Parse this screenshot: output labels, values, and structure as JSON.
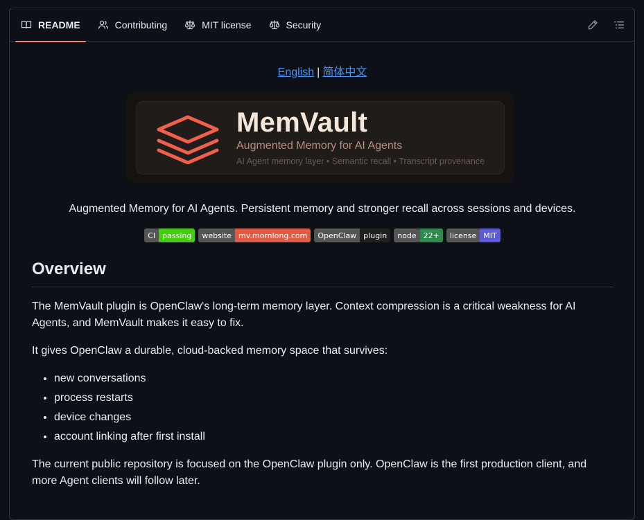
{
  "tabs": [
    {
      "label": "README",
      "icon": "book-icon"
    },
    {
      "label": "Contributing",
      "icon": "people-icon"
    },
    {
      "label": "MIT license",
      "icon": "law-icon"
    },
    {
      "label": "Security",
      "icon": "law-icon"
    }
  ],
  "toolbar": {
    "edit_icon": "pencil-icon",
    "outline_icon": "list-icon"
  },
  "lang": {
    "english": "English",
    "separator": "|",
    "chinese": "简体中文"
  },
  "banner": {
    "name": "MemVault",
    "subtitle": "Augmented Memory for AI Agents",
    "tagline": "AI Agent memory layer • Semantic recall • Transcript provenance",
    "accent": "#f0604d"
  },
  "tagline": "Augmented Memory for AI Agents. Persistent memory and stronger recall across sessions and devices.",
  "badges": [
    {
      "label": "CI",
      "value": "passing",
      "color": "#4c1"
    },
    {
      "label": "website",
      "value": "mv.mornlong.com",
      "color": "#e05d44"
    },
    {
      "label": "OpenClaw",
      "value": "plugin",
      "color": "#1f1f1f"
    },
    {
      "label": "node",
      "value": "22+",
      "color": "#2e8a4e"
    },
    {
      "label": "license",
      "value": "MIT",
      "color": "#5b5bd6"
    }
  ],
  "overview": {
    "heading": "Overview",
    "p1": "The MemVault plugin is OpenClaw's long-term memory layer. Context compression is a critical weakness for AI Agents, and MemVault makes it easy to fix.",
    "p2": "It gives OpenClaw a durable, cloud-backed memory space that survives:",
    "items": [
      "new conversations",
      "process restarts",
      "device changes",
      "account linking after first install"
    ],
    "p3": "The current public repository is focused on the OpenClaw plugin only. OpenClaw is the first production client, and more Agent clients will follow later."
  }
}
